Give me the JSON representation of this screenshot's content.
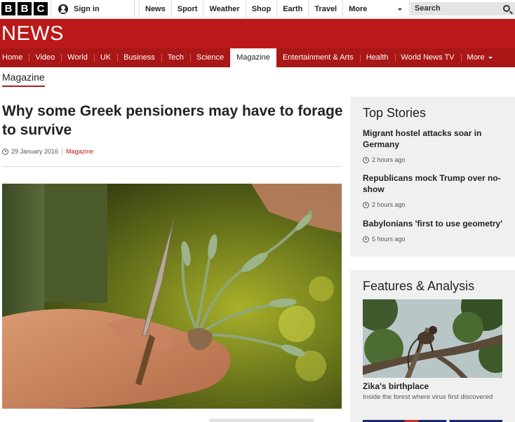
{
  "global_bar": {
    "logo_letters": [
      "B",
      "B",
      "C"
    ],
    "sign_in": "Sign in",
    "nav": [
      "News",
      "Sport",
      "Weather",
      "Shop",
      "Earth",
      "Travel"
    ],
    "more": "More",
    "search_placeholder": "Search"
  },
  "masthead": {
    "title": "NEWS"
  },
  "section_nav": {
    "items": [
      "Home",
      "Video",
      "World",
      "UK",
      "Business",
      "Tech",
      "Science",
      "Magazine",
      "Entertainment & Arts",
      "Health",
      "World News TV"
    ],
    "active": "Magazine",
    "more": "More"
  },
  "section_label": "Magazine",
  "article": {
    "headline": "Why some Greek pensioners may have to forage to survive",
    "date": "29 January 2016",
    "section": "Magazine",
    "hero_icon": "hands-holding-plant-photo"
  },
  "top_stories": {
    "heading": "Top Stories",
    "items": [
      {
        "title": "Migrant hostel attacks soar in Germany",
        "time": "2 hours ago"
      },
      {
        "title": "Republicans mock Trump over no-show",
        "time": "2 hours ago"
      },
      {
        "title": "Babylonians 'first to use geometry'",
        "time": "5 hours ago"
      }
    ]
  },
  "features": {
    "heading": "Features & Analysis",
    "image_icon": "monkey-in-tree-photo",
    "title": "Zika's birthplace",
    "summary": "Inside the forest where virus first discovered"
  },
  "colors": {
    "brand_red": "#bb1919",
    "nav_red": "#a91717",
    "panel_grey": "#f0f0f0"
  }
}
